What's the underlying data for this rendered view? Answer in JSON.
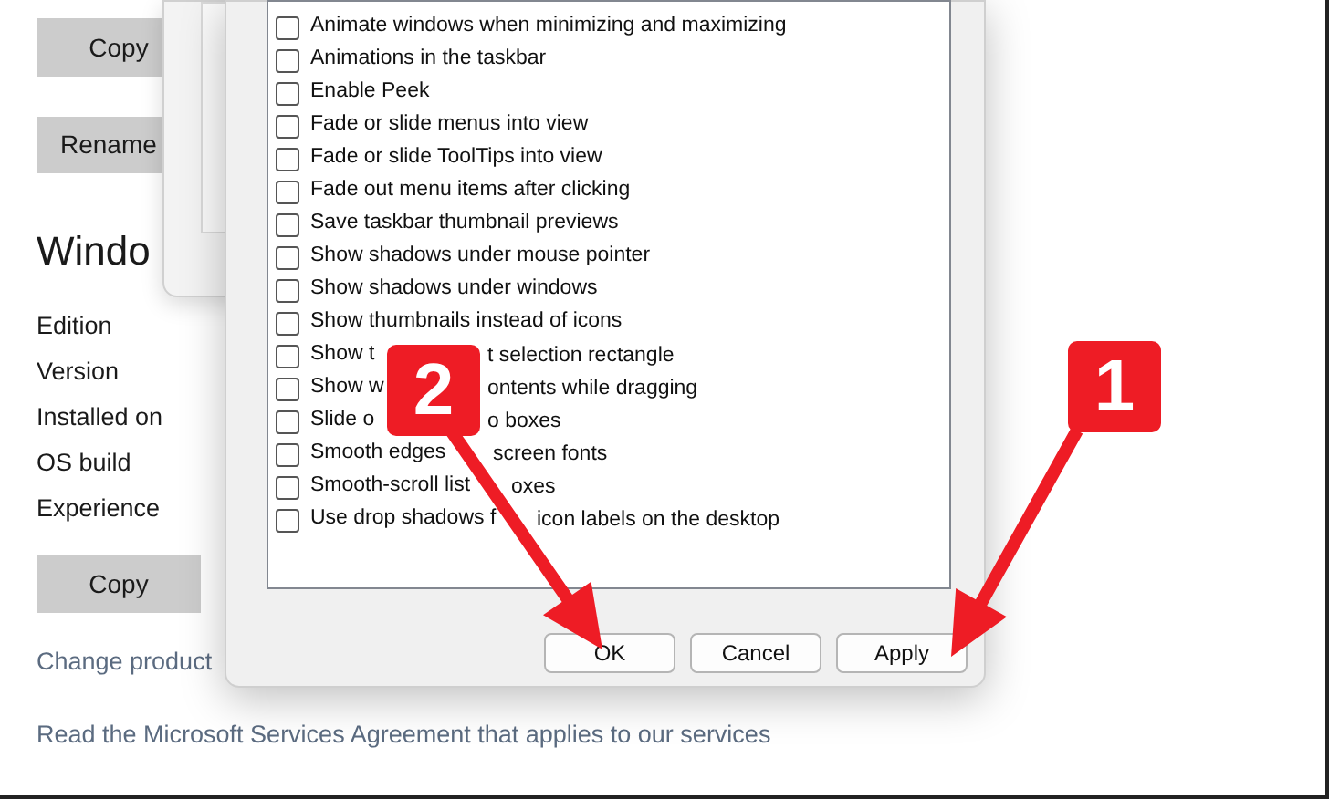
{
  "settings_page": {
    "copy_button": "Copy",
    "rename_button": "Rename",
    "section_title": "Windo",
    "spec_labels": [
      "Edition",
      "Version",
      "Installed on",
      "OS build",
      "Experience"
    ],
    "copy_button_2": "Copy",
    "change_product_link": "Change product",
    "agreement_link": "Read the Microsoft Services Agreement that applies to our services"
  },
  "dialog": {
    "options": [
      {
        "label_parts": [
          "Animate windows when minimizing and maximizing"
        ],
        "checked": false
      },
      {
        "label_parts": [
          "Animations in the taskbar"
        ],
        "checked": false
      },
      {
        "label_parts": [
          "Enable Peek"
        ],
        "checked": false
      },
      {
        "label_parts": [
          "Fade or slide menus into view"
        ],
        "checked": false
      },
      {
        "label_parts": [
          "Fade or slide ToolTips into view"
        ],
        "checked": false
      },
      {
        "label_parts": [
          "Fade out menu items after clicking"
        ],
        "checked": false
      },
      {
        "label_parts": [
          "Save taskbar thumbnail previews"
        ],
        "checked": false
      },
      {
        "label_parts": [
          "Show shadows under mouse pointer"
        ],
        "checked": false
      },
      {
        "label_parts": [
          "Show shadows under windows"
        ],
        "checked": false
      },
      {
        "label_parts": [
          "Show thumbnails instead of icons"
        ],
        "checked": false
      },
      {
        "label_parts": [
          "Show t",
          "t selection rectangle"
        ],
        "checked": false
      },
      {
        "label_parts": [
          "Show w",
          "ontents while dragging"
        ],
        "checked": false
      },
      {
        "label_parts": [
          "Slide o",
          "o boxes"
        ],
        "checked": false
      },
      {
        "label_parts": [
          "Smooth edges",
          "screen fonts"
        ],
        "checked": false
      },
      {
        "label_parts": [
          "Smooth-scroll list",
          "oxes"
        ],
        "checked": false
      },
      {
        "label_parts": [
          "Use drop shadows f",
          "icon labels on the desktop"
        ],
        "checked": false
      }
    ],
    "buttons": [
      "OK",
      "Cancel",
      "Apply"
    ]
  },
  "annotations": [
    {
      "number": "2"
    },
    {
      "number": "1"
    }
  ]
}
